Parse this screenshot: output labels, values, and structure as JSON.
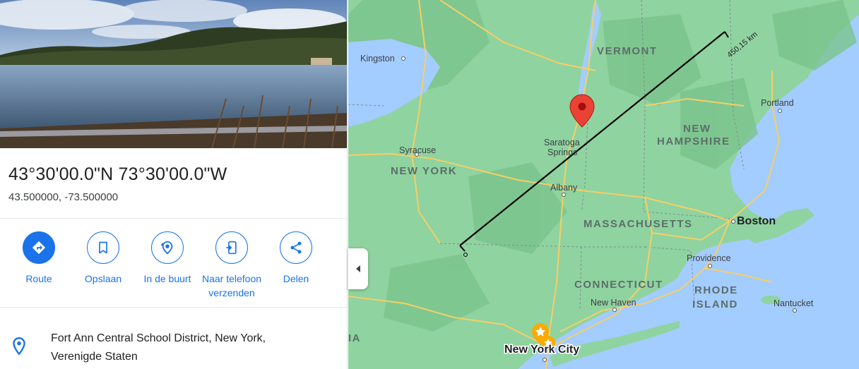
{
  "place": {
    "title": "43°30'00.0\"N 73°30'00.0\"W",
    "decimal": "43.500000, -73.500000",
    "address_line1": "Fort Ann Central School District, New York,",
    "address_line2": "Verenigde Staten"
  },
  "actions": [
    {
      "label": "Route",
      "icon": "directions-icon"
    },
    {
      "label": "Opslaan",
      "icon": "bookmark-icon"
    },
    {
      "label": "In de buurt",
      "icon": "nearby-icon"
    },
    {
      "label_line1": "Naar telefoon",
      "label_line2": "verzenden",
      "icon": "send-to-phone-icon"
    },
    {
      "label": "Delen",
      "icon": "share-icon"
    }
  ],
  "map": {
    "measure_distance": "450,15 km",
    "states": [
      "VERMONT",
      "NEW",
      "HAMPSHIRE",
      "NEW YORK",
      "MASSACHUSETTS",
      "CONNECTICUT",
      "RHODE",
      "ISLAND",
      "IA"
    ],
    "cities": [
      "Kingston",
      "Portland",
      "Syracuse",
      "Saratoga",
      "Springs",
      "Albany",
      "Boston",
      "Providence",
      "New Haven",
      "Nantucket",
      "New York City"
    ]
  },
  "colors": {
    "accent": "#1a73e8",
    "land": "#8fd3a0",
    "water": "#a3ccff",
    "road": "#f6cf65",
    "pin": "#ea4335"
  }
}
